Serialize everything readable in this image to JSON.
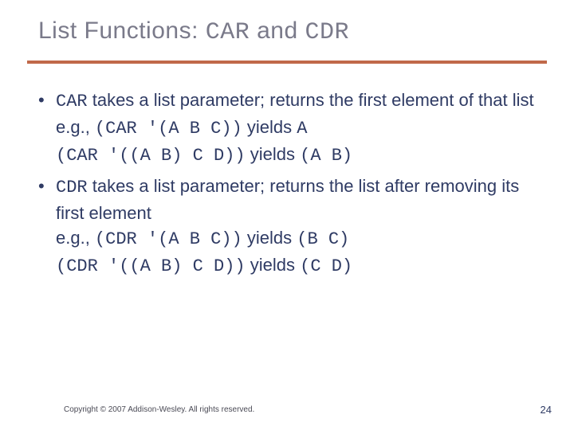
{
  "title": {
    "pre": "List Functions: ",
    "code1": "CAR",
    "mid": " and ",
    "code2": "CDR"
  },
  "bullets": [
    {
      "lead_code": "CAR",
      "lead_text": " takes a list parameter; returns the first element of that list",
      "examples": [
        {
          "prefix": "e.g., ",
          "code": "(CAR '(A B C))",
          "mid": " yields ",
          "result_code": "A"
        },
        {
          "prefix": "",
          "code": "(CAR '((A B) C D))",
          "mid": " yields ",
          "result_code": "(A B)"
        }
      ]
    },
    {
      "lead_code": "CDR",
      "lead_text": " takes a list parameter; returns the list after removing its first element",
      "examples": [
        {
          "prefix": "e.g., ",
          "code": "(CDR '(A B C))",
          "mid": " yields ",
          "result_code": "(B C)"
        },
        {
          "prefix": "",
          "code": "(CDR '((A B) C D))",
          "mid": " yields ",
          "result_code": "(C D)"
        }
      ]
    }
  ],
  "footer": "Copyright © 2007 Addison-Wesley. All rights reserved.",
  "page_number": "24"
}
